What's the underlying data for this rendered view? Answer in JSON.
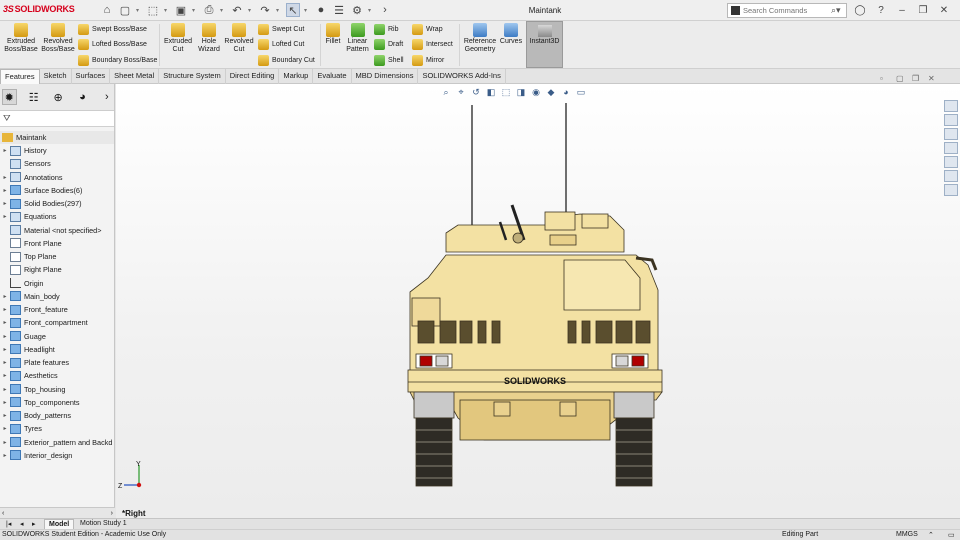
{
  "app": {
    "brand": "SOLIDWORKS",
    "doc_title": "Maintank"
  },
  "search": {
    "placeholder": "Search Commands"
  },
  "ribbon": {
    "extruded_boss": "Extruded Boss/Base",
    "revolved_boss": "Revolved Boss/Base",
    "swept_boss": "Swept Boss/Base",
    "lofted_boss": "Lofted Boss/Base",
    "boundary_boss": "Boundary Boss/Base",
    "extruded_cut": "Extruded Cut",
    "hole_wizard": "Hole Wizard",
    "revolved_cut": "Revolved Cut",
    "swept_cut": "Swept Cut",
    "lofted_cut": "Lofted Cut",
    "boundary_cut": "Boundary Cut",
    "fillet": "Fillet",
    "linear_pattern": "Linear Pattern",
    "rib": "Rib",
    "draft": "Draft",
    "shell": "Shell",
    "wrap": "Wrap",
    "intersect": "Intersect",
    "mirror": "Mirror",
    "reference_geometry": "Reference Geometry",
    "curves": "Curves",
    "instant3d": "Instant3D"
  },
  "tabs": [
    "Features",
    "Sketch",
    "Surfaces",
    "Sheet Metal",
    "Structure System",
    "Direct Editing",
    "Markup",
    "Evaluate",
    "MBD Dimensions",
    "SOLIDWORKS Add-Ins"
  ],
  "tree": {
    "root": "Maintank",
    "items": [
      {
        "label": "History",
        "icon": "history",
        "exp": true
      },
      {
        "label": "Sensors",
        "icon": "sensor",
        "exp": false
      },
      {
        "label": "Annotations",
        "icon": "annotation",
        "exp": true
      },
      {
        "label": "Surface Bodies(6)",
        "icon": "folder",
        "exp": true
      },
      {
        "label": "Solid Bodies(297)",
        "icon": "folder",
        "exp": true
      },
      {
        "label": "Equations",
        "icon": "equation",
        "exp": true
      },
      {
        "label": "Material <not specified>",
        "icon": "material",
        "exp": false
      },
      {
        "label": "Front Plane",
        "icon": "plane",
        "exp": false
      },
      {
        "label": "Top Plane",
        "icon": "plane",
        "exp": false
      },
      {
        "label": "Right Plane",
        "icon": "plane",
        "exp": false
      },
      {
        "label": "Origin",
        "icon": "origin",
        "exp": false
      },
      {
        "label": "Main_body",
        "icon": "folder",
        "exp": true
      },
      {
        "label": "Front_feature",
        "icon": "folder",
        "exp": true
      },
      {
        "label": "Front_compartment",
        "icon": "folder",
        "exp": true
      },
      {
        "label": "Guage",
        "icon": "folder",
        "exp": true
      },
      {
        "label": "Headlight",
        "icon": "folder",
        "exp": true
      },
      {
        "label": "Plate features",
        "icon": "folder",
        "exp": true
      },
      {
        "label": "Aesthetics",
        "icon": "folder",
        "exp": true
      },
      {
        "label": "Top_housing",
        "icon": "folder",
        "exp": true
      },
      {
        "label": "Top_components",
        "icon": "folder",
        "exp": true
      },
      {
        "label": "Body_patterns",
        "icon": "folder",
        "exp": true
      },
      {
        "label": "Tyres",
        "icon": "folder",
        "exp": true
      },
      {
        "label": "Exterior_pattern and Backd",
        "icon": "folder",
        "exp": true
      },
      {
        "label": "Interior_design",
        "icon": "folder",
        "exp": true
      }
    ]
  },
  "viewport": {
    "view_name": "*Right",
    "model_brand_text": "SOLIDWORKS",
    "axis_y": "Y",
    "axis_z": "Z"
  },
  "bottom_tabs": {
    "model": "Model",
    "motion": "Motion Study 1"
  },
  "status": {
    "edition": "SOLIDWORKS Student Edition - Academic Use Only",
    "mode": "Editing Part",
    "units": "MMGS"
  },
  "colors": {
    "vehicle_body": "#f3e1a3",
    "brand_red": "#d6001c",
    "selection_blue": "#9bb0cc"
  }
}
